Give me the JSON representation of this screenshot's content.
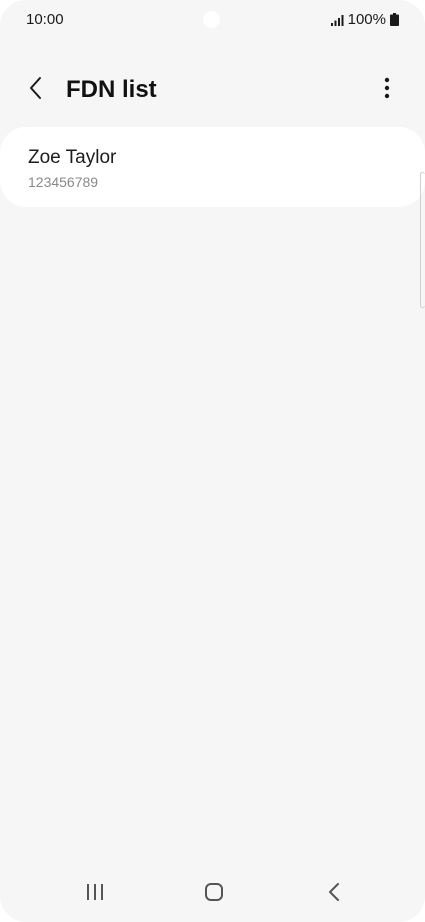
{
  "status_bar": {
    "time": "10:00",
    "battery": "100%",
    "icons": [
      "signal-icon",
      "battery-icon"
    ]
  },
  "app_bar": {
    "title": "FDN list",
    "icons": [
      "back-icon",
      "more-options-icon"
    ]
  },
  "fdn_list": [
    {
      "name": "Zoe Taylor",
      "number": "123456789"
    }
  ],
  "nav_bar": {
    "icons": [
      "recent-apps-icon",
      "home-icon",
      "back-nav-icon"
    ]
  },
  "colors": {
    "background": "#f6f6f6",
    "card": "#ffffff",
    "text_primary": "#111111",
    "text_secondary": "#8a8a8a"
  }
}
